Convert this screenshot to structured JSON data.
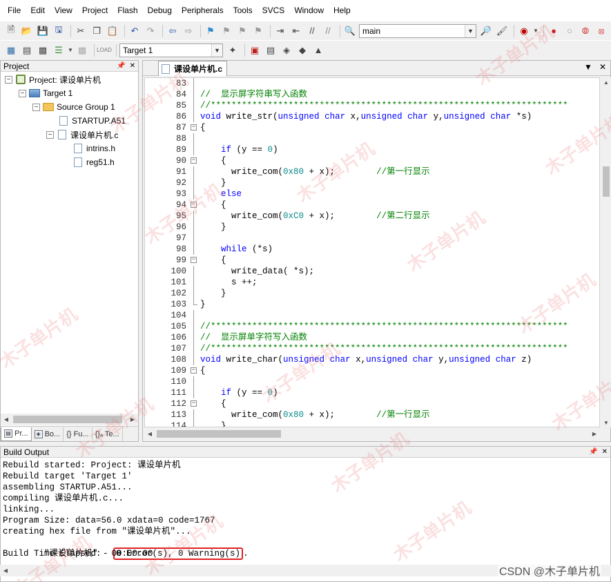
{
  "menu": [
    "File",
    "Edit",
    "View",
    "Project",
    "Flash",
    "Debug",
    "Peripherals",
    "Tools",
    "SVCS",
    "Window",
    "Help"
  ],
  "toolbar": {
    "find_combo": "main",
    "target_combo": "Target 1"
  },
  "project_panel": {
    "title": "Project",
    "tree": {
      "project": "Project: 课设单片机",
      "target": "Target 1",
      "group": "Source Group 1",
      "file_startup": "STARTUP.A51",
      "file_main": "课设单片机.c",
      "file_intrins": "intrins.h",
      "file_reg51": "reg51.h"
    },
    "tabs": [
      "Pr...",
      "Bo...",
      "{} Fu...",
      "{}ₐ Te..."
    ]
  },
  "editor": {
    "tab_label": "课设单片机.c",
    "lines": [
      {
        "n": "83",
        "t": ""
      },
      {
        "n": "84",
        "t": "//  显示屏字符串写入函数"
      },
      {
        "n": "85",
        "t": "//*********************************************************************"
      },
      {
        "n": "86",
        "t": "void write_str(unsigned char x,unsigned char y,unsigned char *s)"
      },
      {
        "n": "87",
        "t": "{"
      },
      {
        "n": "88",
        "t": ""
      },
      {
        "n": "89",
        "t": "    if (y == 0)"
      },
      {
        "n": "90",
        "t": "    {"
      },
      {
        "n": "91",
        "t": "      write_com(0x80 + x);        //第一行显示"
      },
      {
        "n": "92",
        "t": "    }"
      },
      {
        "n": "93",
        "t": "    else"
      },
      {
        "n": "94",
        "t": "    {"
      },
      {
        "n": "95",
        "t": "      write_com(0xC0 + x);        //第二行显示"
      },
      {
        "n": "96",
        "t": "    }"
      },
      {
        "n": "97",
        "t": ""
      },
      {
        "n": "98",
        "t": "    while (*s)"
      },
      {
        "n": "99",
        "t": "    {"
      },
      {
        "n": "100",
        "t": "      write_data( *s);"
      },
      {
        "n": "101",
        "t": "      s ++;"
      },
      {
        "n": "102",
        "t": "    }"
      },
      {
        "n": "103",
        "t": "}"
      },
      {
        "n": "104",
        "t": ""
      },
      {
        "n": "105",
        "t": "//*********************************************************************"
      },
      {
        "n": "106",
        "t": "//  显示屏单字符写入函数"
      },
      {
        "n": "107",
        "t": "//*********************************************************************"
      },
      {
        "n": "108",
        "t": "void write_char(unsigned char x,unsigned char y,unsigned char z)"
      },
      {
        "n": "109",
        "t": "{"
      },
      {
        "n": "110",
        "t": ""
      },
      {
        "n": "111",
        "t": "    if (y == 0)"
      },
      {
        "n": "112",
        "t": "    {"
      },
      {
        "n": "113",
        "t": "      write_com(0x80 + x);        //第一行显示"
      },
      {
        "n": "114",
        "t": "    }"
      }
    ]
  },
  "build_output": {
    "title": "Build Output",
    "lines": [
      "Rebuild started: Project: 课设单片机",
      "Rebuild target 'Target 1'",
      "assembling STARTUP.A51...",
      "compiling 课设单片机.c...",
      "linking...",
      "Program Size: data=56.0 xdata=0 code=1767",
      "creating hex file from \"课设单片机\"..."
    ],
    "result_prefix": "\"课设单片机\" - ",
    "result_highlight": "0 Error(s), 0 Warning(s)",
    "result_suffix": ".",
    "elapsed": "Build Time Elapsed:  00:00:00"
  },
  "watermark": {
    "text": "木子单片机",
    "credit": "CSDN @木子单片机"
  }
}
